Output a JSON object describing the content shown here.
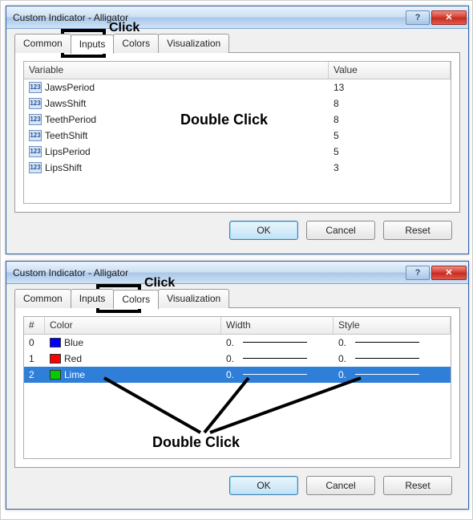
{
  "dialog1": {
    "title": "Custom Indicator - Alligator",
    "tabs": {
      "common": "Common",
      "inputs": "Inputs",
      "colors": "Colors",
      "visualization": "Visualization"
    },
    "active_tab": "inputs",
    "headers": {
      "variable": "Variable",
      "value": "Value"
    },
    "rows": [
      {
        "name": "JawsPeriod",
        "value": "13"
      },
      {
        "name": "JawsShift",
        "value": "8"
      },
      {
        "name": "TeethPeriod",
        "value": "8"
      },
      {
        "name": "TeethShift",
        "value": "5"
      },
      {
        "name": "LipsPeriod",
        "value": "5"
      },
      {
        "name": "LipsShift",
        "value": "3"
      }
    ],
    "buttons": {
      "ok": "OK",
      "cancel": "Cancel",
      "reset": "Reset"
    }
  },
  "dialog2": {
    "title": "Custom Indicator - Alligator",
    "tabs": {
      "common": "Common",
      "inputs": "Inputs",
      "colors": "Colors",
      "visualization": "Visualization"
    },
    "active_tab": "colors",
    "headers": {
      "index": "#",
      "color": "Color",
      "width": "Width",
      "style": "Style"
    },
    "rows": [
      {
        "index": "0",
        "color_name": "Blue",
        "swatch": "#0000ff",
        "width": "0.",
        "style": "0."
      },
      {
        "index": "1",
        "color_name": "Red",
        "swatch": "#ff0000",
        "width": "0.",
        "style": "0."
      },
      {
        "index": "2",
        "color_name": "Lime",
        "swatch": "#00cc00",
        "width": "0.",
        "style": "0.",
        "selected": true
      }
    ],
    "buttons": {
      "ok": "OK",
      "cancel": "Cancel",
      "reset": "Reset"
    }
  },
  "annotations": {
    "click1": "Click",
    "double_click1": "Double Click",
    "click2": "Click",
    "double_click2": "Double Click"
  },
  "titlebar": {
    "help": "?",
    "close": "✕"
  },
  "icon_label": "123"
}
